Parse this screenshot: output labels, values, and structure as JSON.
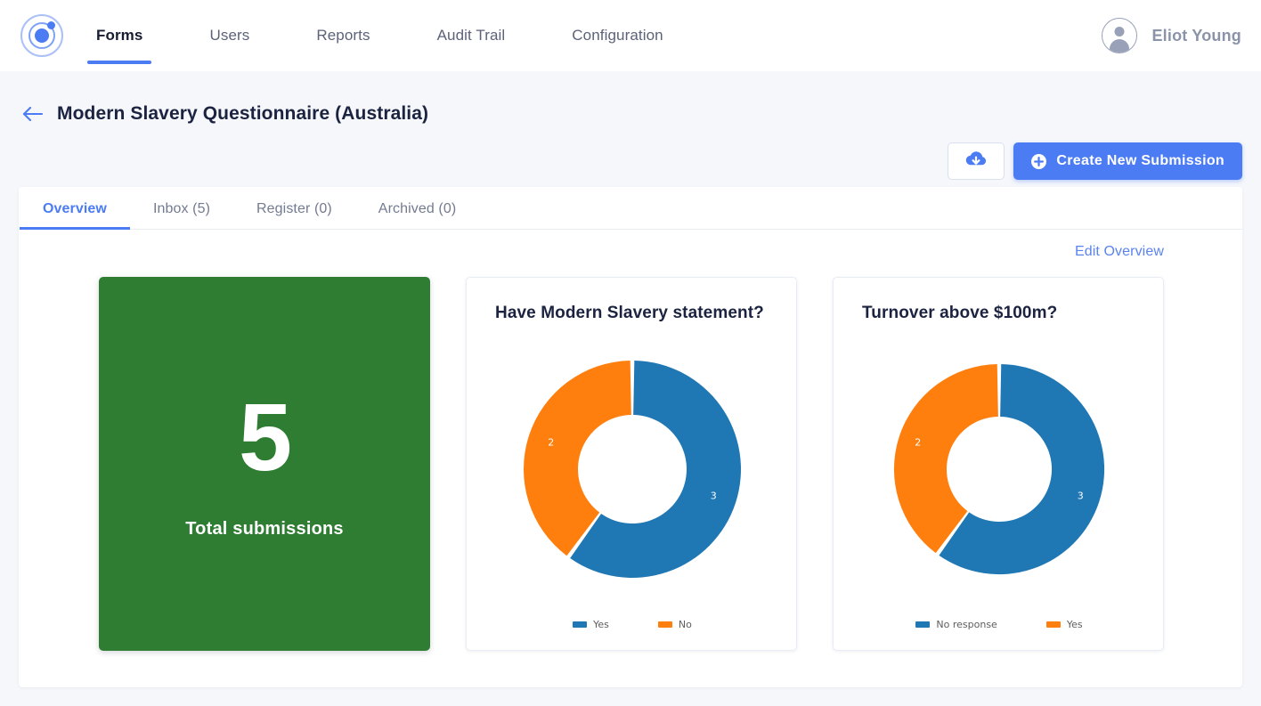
{
  "topnav": {
    "logo_icon": "orbit-logo-icon",
    "items": [
      {
        "label": "Forms",
        "active": true
      },
      {
        "label": "Users",
        "active": false
      },
      {
        "label": "Reports",
        "active": false
      },
      {
        "label": "Audit Trail",
        "active": false
      },
      {
        "label": "Configuration",
        "active": false
      }
    ],
    "user": {
      "name": "Eliot Young",
      "avatar_icon": "person-avatar-icon"
    }
  },
  "page": {
    "back_icon": "arrow-left-icon",
    "title": "Modern Slavery Questionnaire (Australia)"
  },
  "actions": {
    "download_icon": "cloud-download-icon",
    "create_icon": "plus-circle-icon",
    "create_label": "Create New Submission"
  },
  "tabs": [
    {
      "label": "Overview",
      "active": true
    },
    {
      "label": "Inbox (5)",
      "active": false
    },
    {
      "label": "Register (0)",
      "active": false
    },
    {
      "label": "Archived (0)",
      "active": false
    }
  ],
  "overview": {
    "edit_link": "Edit Overview",
    "stat": {
      "value": "5",
      "label": "Total submissions"
    }
  },
  "colors": {
    "accent_blue": "#4c7cf4",
    "stat_green": "#2e7d32",
    "series_blue": "#1f77b4",
    "series_orange": "#ff7f0e",
    "page_background": "#f5f7fb",
    "title_text": "#1b2340",
    "muted_text": "#737b91"
  },
  "chart_data": [
    {
      "type": "pie",
      "title": "Have Modern Slavery statement?",
      "donut": true,
      "labels": [
        "Yes",
        "No"
      ],
      "values": [
        3,
        2
      ],
      "colors": [
        "#1f77b4",
        "#ff7f0e"
      ],
      "data_labels": [
        "3",
        "2"
      ],
      "legend_position": "bottom",
      "total": 5
    },
    {
      "type": "pie",
      "title": "Turnover above $100m?",
      "donut": true,
      "labels": [
        "No response",
        "Yes"
      ],
      "values": [
        3,
        2
      ],
      "colors": [
        "#1f77b4",
        "#ff7f0e"
      ],
      "data_labels": [
        "3",
        "2"
      ],
      "legend_position": "bottom",
      "total": 5
    }
  ]
}
